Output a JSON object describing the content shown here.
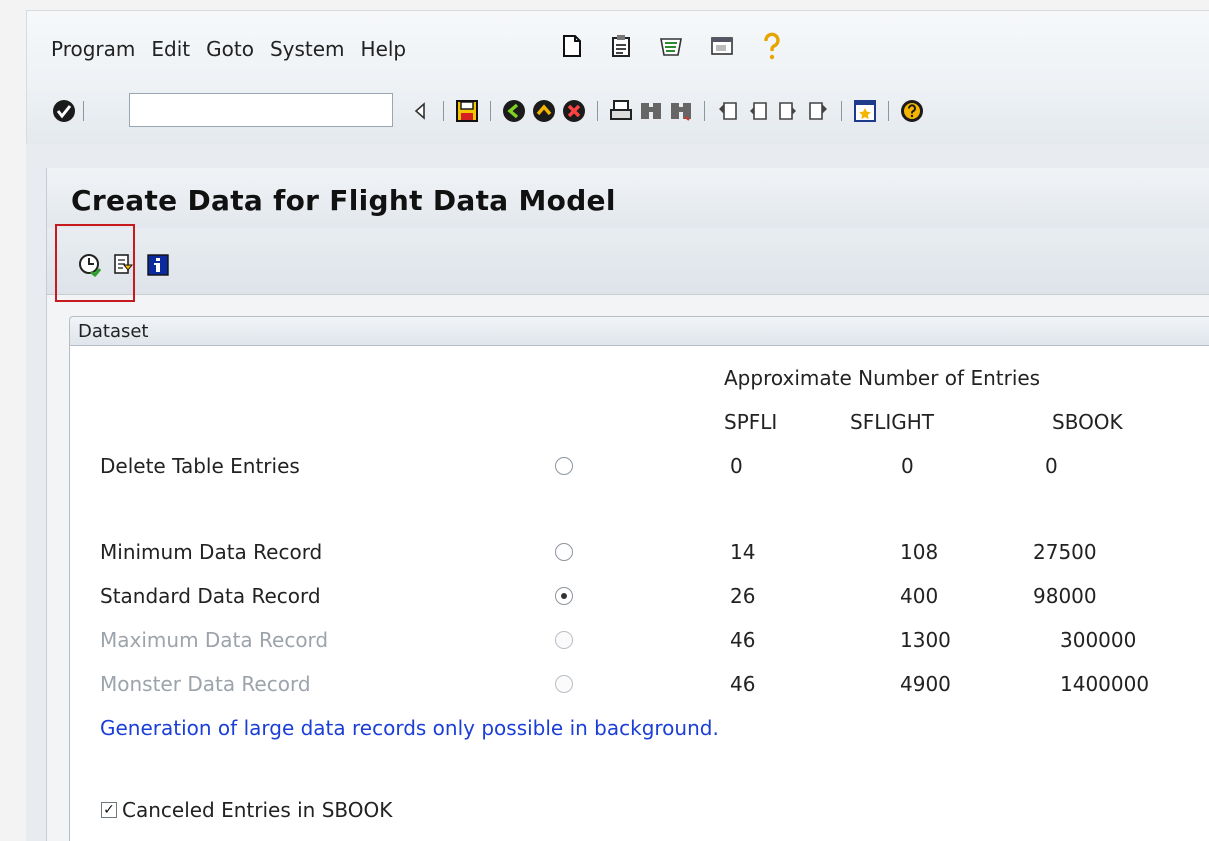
{
  "menu": [
    "Program",
    "Edit",
    "Goto",
    "System",
    "Help"
  ],
  "title": "Create Data for Flight Data Model",
  "command_field": {
    "value": ""
  },
  "dataset": {
    "tab_label": "Dataset",
    "header": "Approximate Number of Entries",
    "columns": [
      "SPFLI",
      "SFLIGHT",
      "SBOOK"
    ],
    "rows": [
      {
        "label": "Delete Table Entries",
        "spfli": "0",
        "sflight": "0",
        "sbook": "0",
        "selected": false,
        "enabled": true
      },
      {
        "label": "Minimum Data Record",
        "spfli": "14",
        "sflight": "108",
        "sbook": "27500",
        "selected": false,
        "enabled": true
      },
      {
        "label": "Standard Data Record",
        "spfli": "26",
        "sflight": "400",
        "sbook": "98000",
        "selected": true,
        "enabled": true
      },
      {
        "label": "Maximum Data Record",
        "spfli": "46",
        "sflight": "1300",
        "sbook": "300000",
        "selected": false,
        "enabled": false
      },
      {
        "label": "Monster Data Record",
        "spfli": "46",
        "sflight": "4900",
        "sbook": "1400000",
        "selected": false,
        "enabled": false
      }
    ],
    "note": "Generation of large data records only possible in background.",
    "checkbox": {
      "label": "Canceled Entries in SBOOK",
      "checked": true
    }
  },
  "colors": {
    "note": "#1b3fd6",
    "disabled_text": "#9ca3aa",
    "highlight": "#c8191e"
  },
  "icons": {
    "menubar": [
      "new-session-icon",
      "shortcut-icon",
      "layout-menu-icon",
      "window-icon",
      "help-icon"
    ],
    "toolbar": [
      "enter-icon",
      "command-arrow-icon",
      "save-icon",
      "back-icon",
      "exit-icon",
      "cancel-icon",
      "print-icon",
      "find-icon",
      "find-next-icon",
      "first-page-icon",
      "previous-page-icon",
      "next-page-icon",
      "last-page-icon",
      "customize-layout-icon",
      "help-icon"
    ],
    "app": [
      "execute-icon",
      "program-documentation-icon",
      "information-icon"
    ]
  }
}
